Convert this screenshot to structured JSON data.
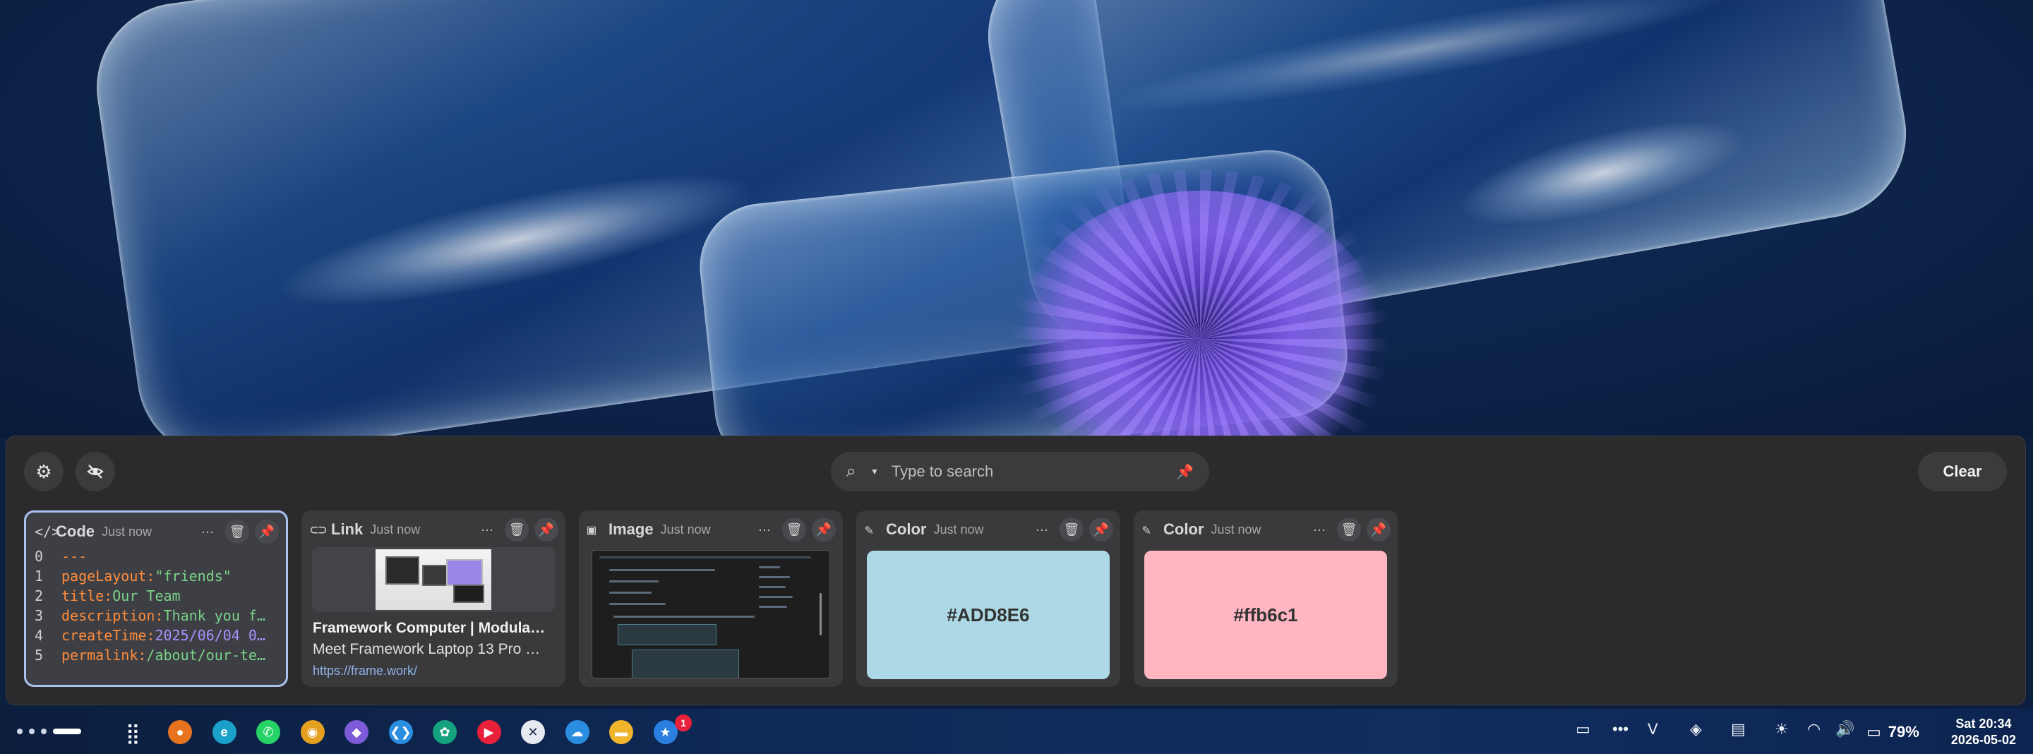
{
  "search": {
    "placeholder": "Type to search"
  },
  "toolbar": {
    "clear_label": "Clear"
  },
  "cards": [
    {
      "type": "Code",
      "time": "Just now",
      "lines": [
        {
          "num": "0",
          "key": "---",
          "value": ""
        },
        {
          "num": "1",
          "key": "pageLayout:",
          "value": " \"friends\""
        },
        {
          "num": "2",
          "key": "title:",
          "value": " Our Team"
        },
        {
          "num": "3",
          "key": "description:",
          "value": " Thank you f…"
        },
        {
          "num": "4",
          "key": "createTime:",
          "value": " 2025/06/04 0…"
        },
        {
          "num": "5",
          "key": "permalink:",
          "value": " /about/our-te…"
        }
      ]
    },
    {
      "type": "Link",
      "time": "Just now",
      "title": "Framework Computer | Modula…",
      "description": "Meet Framework Laptop 13 Pro …",
      "url": "https://frame.work/"
    },
    {
      "type": "Image",
      "time": "Just now"
    },
    {
      "type": "Color",
      "time": "Just now",
      "value": "#ADD8E6",
      "hex": "#ADD8E6"
    },
    {
      "type": "Color",
      "time": "Just now",
      "value": "#ffb6c1",
      "hex": "#ffb6c1"
    }
  ],
  "taskbar": {
    "apps": [
      {
        "name": "firefox-icon",
        "color": "#e8731f",
        "glyph": "●"
      },
      {
        "name": "edge-icon",
        "color": "#1aa0c9",
        "glyph": "e"
      },
      {
        "name": "whatsapp-icon",
        "color": "#25d366",
        "glyph": "✆"
      },
      {
        "name": "chrome-icon",
        "color": "#e6a020",
        "glyph": "◉"
      },
      {
        "name": "obsidian-icon",
        "color": "#7c5ad8",
        "glyph": "◆"
      },
      {
        "name": "vscode-icon",
        "color": "#2b8de0",
        "glyph": "❮❯"
      },
      {
        "name": "chatgpt-icon",
        "color": "#15a37f",
        "glyph": "✿"
      },
      {
        "name": "youtube-music-icon",
        "color": "#e8203a",
        "glyph": "▶"
      },
      {
        "name": "x-app-icon",
        "color": "#e6e9ef",
        "glyph": "✕"
      },
      {
        "name": "onedrive-icon",
        "color": "#2b8de0",
        "glyph": "☁"
      },
      {
        "name": "files-icon",
        "color": "#f0b52a",
        "glyph": "▬"
      },
      {
        "name": "app-store-icon",
        "color": "#2b7fe0",
        "glyph": "★"
      }
    ],
    "badge_count": "1",
    "battery_percent": "79%",
    "time": "Sat 20:34",
    "date": "2026-05-02"
  }
}
